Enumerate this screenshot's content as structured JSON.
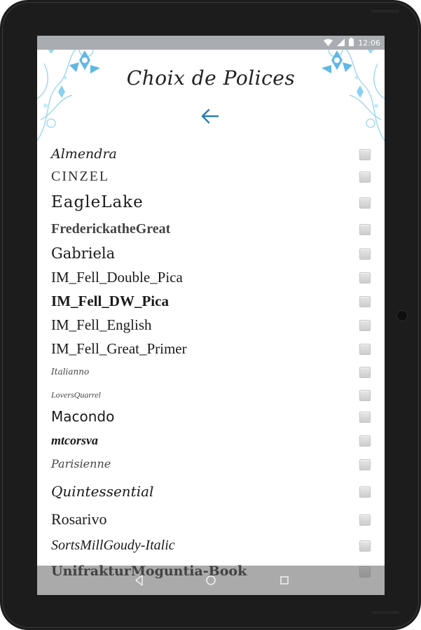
{
  "status_bar": {
    "time": "12:06"
  },
  "header": {
    "title": "Choix de Polices"
  },
  "fonts": [
    {
      "name": "Almendra"
    },
    {
      "name": "Cinzel"
    },
    {
      "name": "EagleLake"
    },
    {
      "name": "FrederickatheGreat"
    },
    {
      "name": "Gabriela"
    },
    {
      "name": "IM_Fell_Double_Pica"
    },
    {
      "name": "IM_Fell_DW_Pica"
    },
    {
      "name": "IM_Fell_English"
    },
    {
      "name": "IM_Fell_Great_Primer"
    },
    {
      "name": "Italianno"
    },
    {
      "name": "LoversQuarrel"
    },
    {
      "name": "Macondo"
    },
    {
      "name": "mtcorsva"
    },
    {
      "name": "Parisienne"
    },
    {
      "name": "Quintessential"
    },
    {
      "name": "Rosarivo"
    },
    {
      "name": "SortsMillGoudy-Italic"
    },
    {
      "name": "UnifrakturMoguntia-Book"
    }
  ],
  "colors": {
    "accent": "#2a7fb0",
    "floral": "#5ab8e0"
  },
  "icons": {
    "back": "arrow-left-icon"
  }
}
